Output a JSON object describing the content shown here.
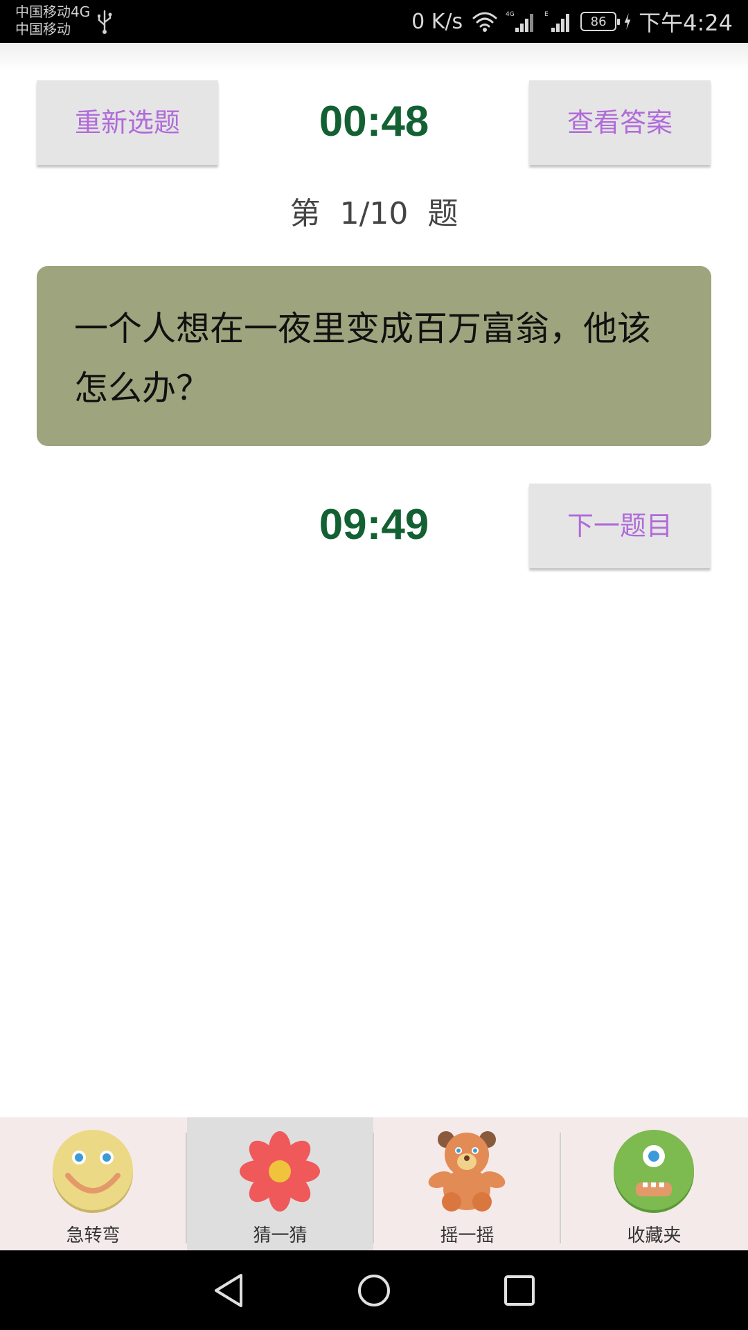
{
  "status_bar": {
    "carrier_line1": "中国移动4G",
    "carrier_line2": "中国移动",
    "net_speed": "0 K/s",
    "battery": "86",
    "time": "下午4:24"
  },
  "header": {
    "reselect_label": "重新选题",
    "timer_top": "00:48",
    "answer_label": "查看答案"
  },
  "progress": "第  1/10  题",
  "question": "一个人想在一夜里变成百万富翁，他该怎么办？",
  "bottom_row": {
    "timer": "09:49",
    "next_label": "下一题目"
  },
  "tabs": [
    {
      "label": "急转弯",
      "icon": "smiley-face-icon",
      "active": false
    },
    {
      "label": "猜一猜",
      "icon": "red-flower-icon",
      "active": true
    },
    {
      "label": "摇一摇",
      "icon": "teddy-bear-icon",
      "active": false
    },
    {
      "label": "收藏夹",
      "icon": "green-monster-icon",
      "active": false
    }
  ],
  "colors": {
    "accent_text": "#b06bd9",
    "timer": "#136133",
    "card": "#9ea47d",
    "tab_bar": "#f5eaea"
  }
}
